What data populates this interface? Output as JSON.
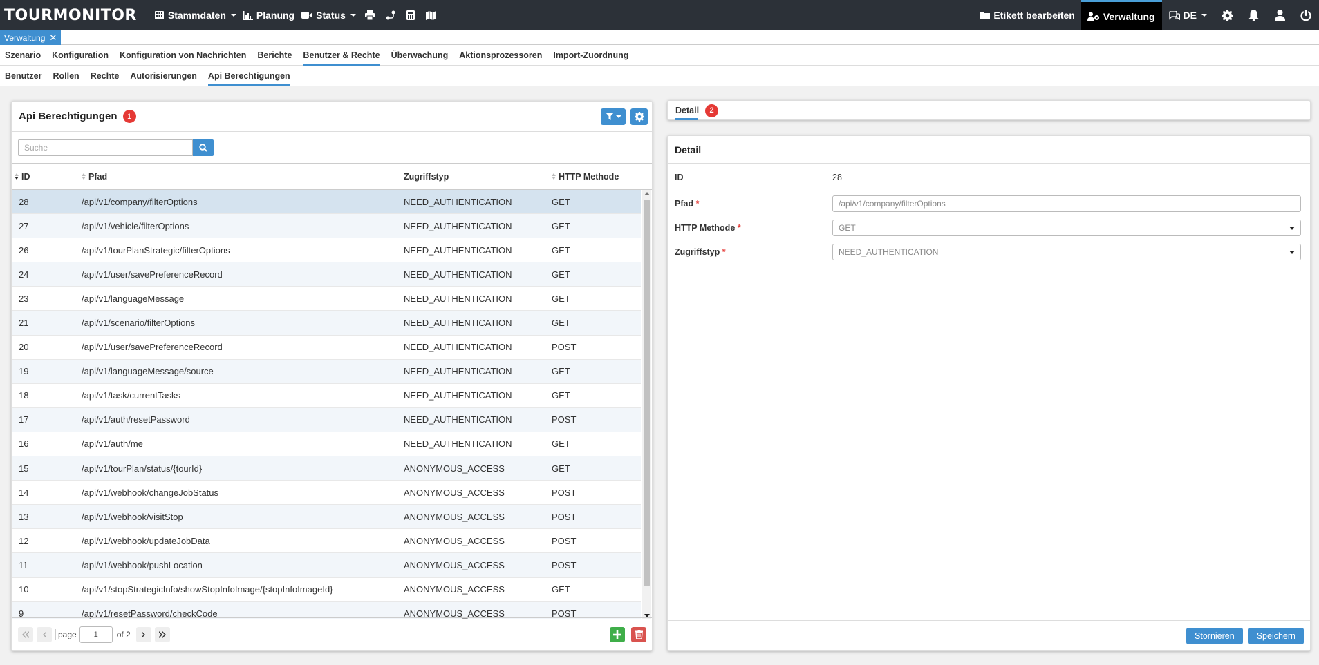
{
  "app": {
    "logo": "TOURMONITOR",
    "nav": {
      "stammdaten": "Stammdaten",
      "planung": "Planung",
      "status": "Status"
    },
    "right_nav": {
      "etikett": "Etikett bearbeiten",
      "verwaltung": "Verwaltung",
      "language": "DE"
    },
    "open_tab": "Verwaltung",
    "colors": {
      "topbar": "#2c3138",
      "accent": "#3f8fd0",
      "badge": "#e53935",
      "add": "#3fae49",
      "delete": "#d9534f"
    }
  },
  "menu1": [
    "Szenario",
    "Konfiguration",
    "Konfiguration von Nachrichten",
    "Berichte",
    "Benutzer & Rechte",
    "Überwachung",
    "Aktionsprozessoren",
    "Import-Zuordnung"
  ],
  "menu1_active": "Benutzer & Rechte",
  "menu2": [
    "Benutzer",
    "Rollen",
    "Rechte",
    "Autorisierungen",
    "Api Berechtigungen"
  ],
  "menu2_active": "Api Berechtigungen",
  "list": {
    "title": "Api Berechtigungen",
    "badge": "1",
    "search_placeholder": "Suche",
    "columns": {
      "id": "ID",
      "pfad": "Pfad",
      "zugriffstyp": "Zugriffstyp",
      "http": "HTTP Methode"
    },
    "rows": [
      [
        "28",
        "/api/v1/company/filterOptions",
        "NEED_AUTHENTICATION",
        "GET"
      ],
      [
        "27",
        "/api/v1/vehicle/filterOptions",
        "NEED_AUTHENTICATION",
        "GET"
      ],
      [
        "26",
        "/api/v1/tourPlanStrategic/filterOptions",
        "NEED_AUTHENTICATION",
        "GET"
      ],
      [
        "24",
        "/api/v1/user/savePreferenceRecord",
        "NEED_AUTHENTICATION",
        "GET"
      ],
      [
        "23",
        "/api/v1/languageMessage",
        "NEED_AUTHENTICATION",
        "GET"
      ],
      [
        "21",
        "/api/v1/scenario/filterOptions",
        "NEED_AUTHENTICATION",
        "GET"
      ],
      [
        "20",
        "/api/v1/user/savePreferenceRecord",
        "NEED_AUTHENTICATION",
        "POST"
      ],
      [
        "19",
        "/api/v1/languageMessage/source",
        "NEED_AUTHENTICATION",
        "GET"
      ],
      [
        "18",
        "/api/v1/task/currentTasks",
        "NEED_AUTHENTICATION",
        "GET"
      ],
      [
        "17",
        "/api/v1/auth/resetPassword",
        "NEED_AUTHENTICATION",
        "POST"
      ],
      [
        "16",
        "/api/v1/auth/me",
        "NEED_AUTHENTICATION",
        "GET"
      ],
      [
        "15",
        "/api/v1/tourPlan/status/{tourId}",
        "ANONYMOUS_ACCESS",
        "GET"
      ],
      [
        "14",
        "/api/v1/webhook/changeJobStatus",
        "ANONYMOUS_ACCESS",
        "POST"
      ],
      [
        "13",
        "/api/v1/webhook/visitStop",
        "ANONYMOUS_ACCESS",
        "POST"
      ],
      [
        "12",
        "/api/v1/webhook/updateJobData",
        "ANONYMOUS_ACCESS",
        "POST"
      ],
      [
        "11",
        "/api/v1/webhook/pushLocation",
        "ANONYMOUS_ACCESS",
        "POST"
      ],
      [
        "10",
        "/api/v1/stopStrategicInfo/showStopInfoImage/{stopInfoImageId}",
        "ANONYMOUS_ACCESS",
        "GET"
      ],
      [
        "9",
        "/api/v1/resetPassword/checkCode",
        "ANONYMOUS_ACCESS",
        "POST"
      ]
    ],
    "pager": {
      "page_label": "page",
      "page_value": "1",
      "of_label": "of 2"
    }
  },
  "detail": {
    "tab_label": "Detail",
    "tab_badge": "2",
    "title": "Detail",
    "fields": {
      "id_label": "ID",
      "id_value": "28",
      "pfad_label": "Pfad",
      "pfad_value": "/api/v1/company/filterOptions",
      "http_label": "HTTP Methode",
      "http_value": "GET",
      "typ_label": "Zugriffstyp",
      "typ_value": "NEED_AUTHENTICATION"
    },
    "buttons": {
      "cancel": "Stornieren",
      "save": "Speichern"
    }
  }
}
